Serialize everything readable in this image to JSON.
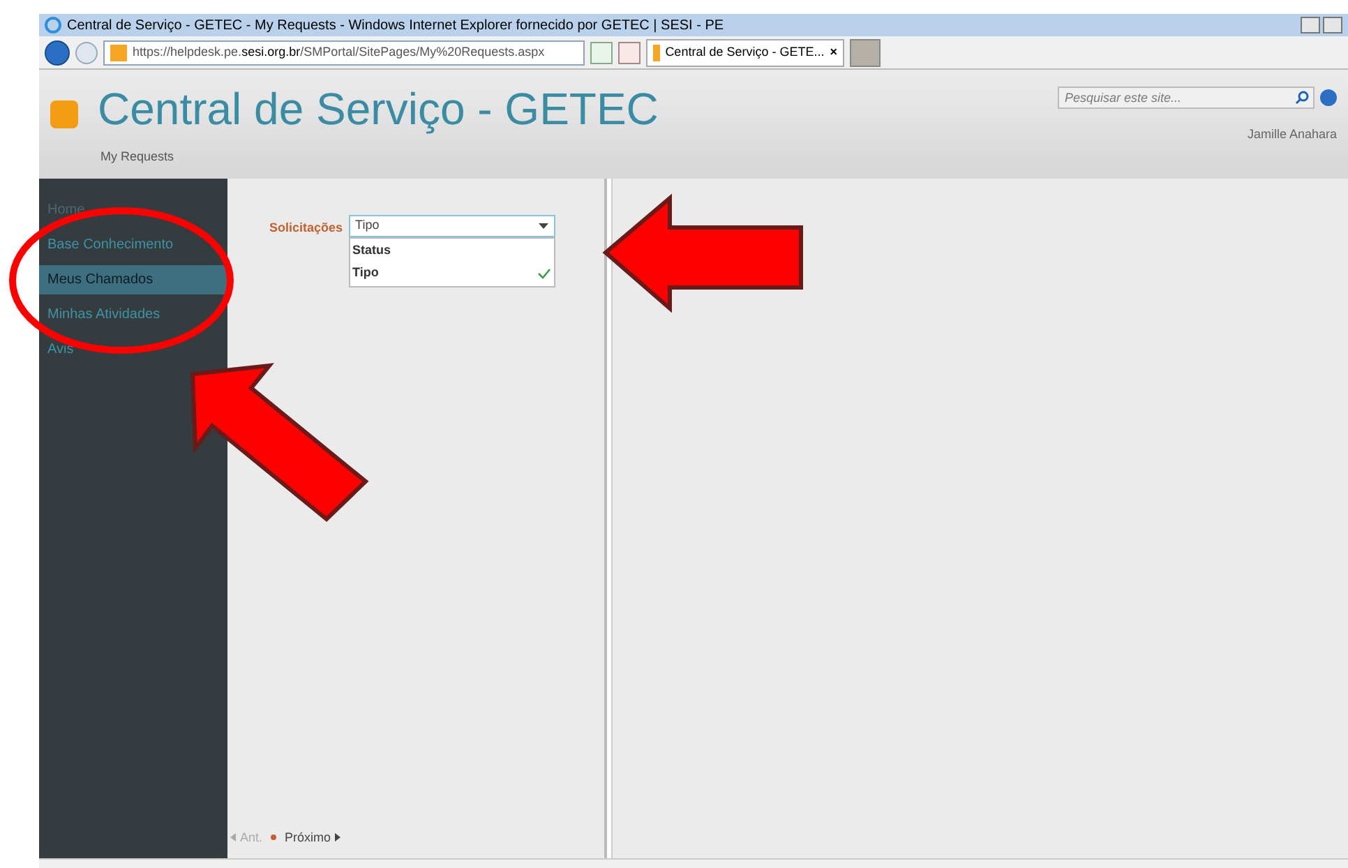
{
  "window": {
    "title": "Central de Serviço - GETEC - My Requests - Windows Internet Explorer fornecido por GETEC | SESI - PE"
  },
  "address_bar": {
    "url_prefix": "https://helpdesk.pe.",
    "url_domain": "sesi.org.br",
    "url_path": "/SMPortal/SitePages/My%20Requests.aspx"
  },
  "tab": {
    "label": "Central de Serviço - GETE...",
    "close": "×"
  },
  "search": {
    "placeholder": "Pesquisar este site..."
  },
  "site": {
    "title": "Central de Serviço - GETEC",
    "breadcrumb": "My Requests",
    "user": "Jamille Anahara"
  },
  "nav": [
    {
      "label": "Home",
      "selected": false
    },
    {
      "label": "Base Conhecimento",
      "selected": false
    },
    {
      "label": "Meus Chamados",
      "selected": true
    },
    {
      "label": "Minhas Atividades",
      "selected": false
    },
    {
      "label": "Avis",
      "selected": false
    }
  ],
  "filter": {
    "label": "Solicitações",
    "value": "Tipo",
    "options": [
      {
        "label": "Status",
        "selected": false
      },
      {
        "label": "Tipo",
        "selected": true
      }
    ]
  },
  "pager": {
    "prev": "Ant.",
    "prev_disabled": true,
    "next": "Próximo",
    "next_disabled": false
  }
}
